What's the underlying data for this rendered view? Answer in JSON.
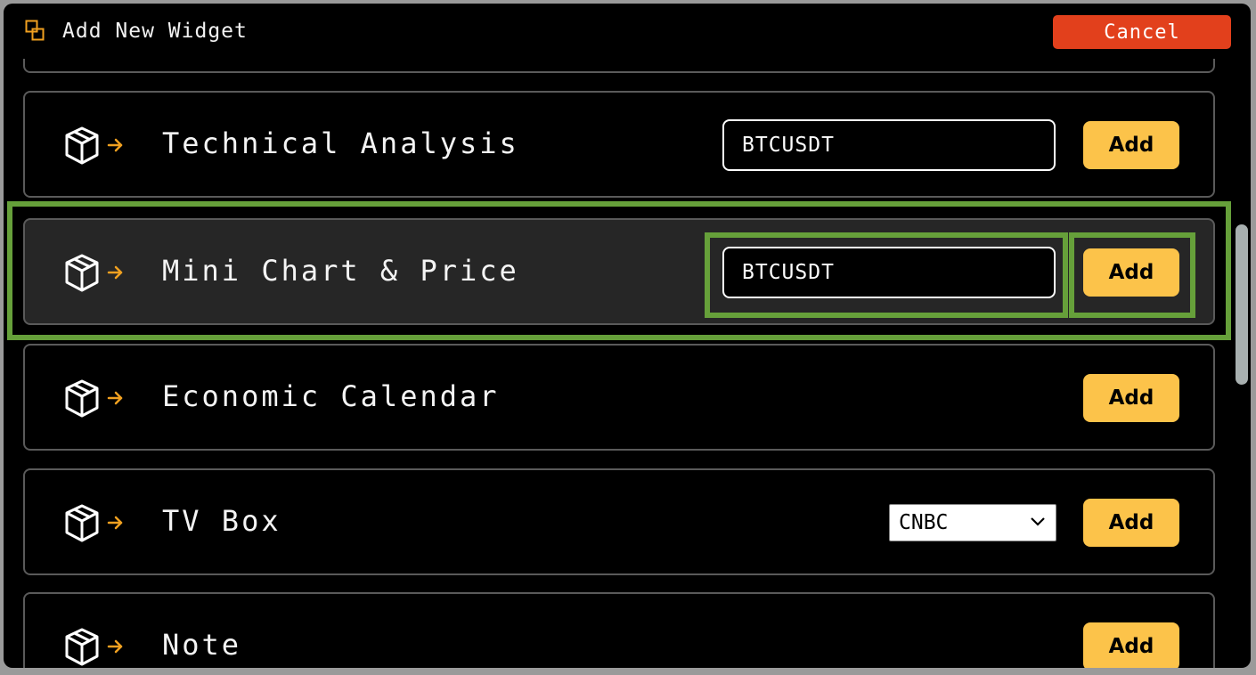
{
  "header": {
    "title": "Add New Widget",
    "cancel_label": "Cancel"
  },
  "widgets": [
    {
      "title": "Technical Analysis",
      "symbol": "BTCUSDT",
      "add_label": "Add"
    },
    {
      "title": "Mini Chart & Price",
      "symbol": "BTCUSDT",
      "add_label": "Add"
    },
    {
      "title": "Economic Calendar",
      "add_label": "Add"
    },
    {
      "title": "TV Box",
      "channel": "CNBC",
      "add_label": "Add"
    },
    {
      "title": "Note",
      "add_label": "Add"
    }
  ],
  "icons": {
    "header": "copy-icon",
    "widget": "package-icon",
    "arrow": "arrow-right-icon",
    "select": "chevron-down-icon"
  },
  "colors": {
    "accent": "#fcc34a",
    "cancel": "#e2401c",
    "highlight": "#66a03a",
    "arrow": "#f0a020"
  }
}
